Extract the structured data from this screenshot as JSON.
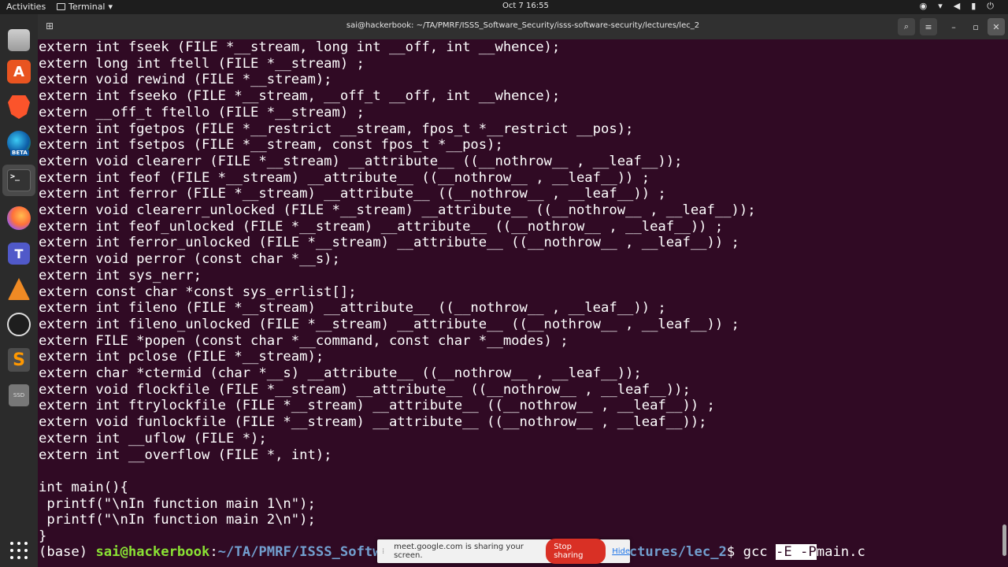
{
  "topbar": {
    "activities": "Activities",
    "app_name": "Terminal",
    "clock": "Oct 7  16:55"
  },
  "dock": {
    "items": [
      "files",
      "app-center",
      "brave",
      "edge-beta",
      "terminal",
      "firefox",
      "teams",
      "vlc",
      "obs",
      "sublime-text",
      "ssd"
    ],
    "edge_badge": "BETA",
    "ssd_label": "SSD"
  },
  "window": {
    "title": "sai@hackerbook: ~/TA/PMRF/ISSS_Software_Security/isss-software-security/lectures/lec_2"
  },
  "terminal": {
    "lines": [
      "extern int fseek (FILE *__stream, long int __off, int __whence);",
      "extern long int ftell (FILE *__stream) ;",
      "extern void rewind (FILE *__stream);",
      "extern int fseeko (FILE *__stream, __off_t __off, int __whence);",
      "extern __off_t ftello (FILE *__stream) ;",
      "extern int fgetpos (FILE *__restrict __stream, fpos_t *__restrict __pos);",
      "extern int fsetpos (FILE *__stream, const fpos_t *__pos);",
      "extern void clearerr (FILE *__stream) __attribute__ ((__nothrow__ , __leaf__));",
      "extern int feof (FILE *__stream) __attribute__ ((__nothrow__ , __leaf__)) ;",
      "extern int ferror (FILE *__stream) __attribute__ ((__nothrow__ , __leaf__)) ;",
      "extern void clearerr_unlocked (FILE *__stream) __attribute__ ((__nothrow__ , __leaf__));",
      "extern int feof_unlocked (FILE *__stream) __attribute__ ((__nothrow__ , __leaf__)) ;",
      "extern int ferror_unlocked (FILE *__stream) __attribute__ ((__nothrow__ , __leaf__)) ;",
      "extern void perror (const char *__s);",
      "extern int sys_nerr;",
      "extern const char *const sys_errlist[];",
      "extern int fileno (FILE *__stream) __attribute__ ((__nothrow__ , __leaf__)) ;",
      "extern int fileno_unlocked (FILE *__stream) __attribute__ ((__nothrow__ , __leaf__)) ;",
      "extern FILE *popen (const char *__command, const char *__modes) ;",
      "extern int pclose (FILE *__stream);",
      "extern char *ctermid (char *__s) __attribute__ ((__nothrow__ , __leaf__));",
      "extern void flockfile (FILE *__stream) __attribute__ ((__nothrow__ , __leaf__));",
      "extern int ftrylockfile (FILE *__stream) __attribute__ ((__nothrow__ , __leaf__)) ;",
      "extern void funlockfile (FILE *__stream) __attribute__ ((__nothrow__ , __leaf__));",
      "extern int __uflow (FILE *);",
      "extern int __overflow (FILE *, int);",
      "",
      "int main(){",
      " printf(\"\\nIn function main 1\\n\");",
      " printf(\"\\nIn function main 2\\n\");",
      "}"
    ],
    "prompt": {
      "prefix": "(base) ",
      "user_host": "sai@hackerbook",
      "colon": ":",
      "path": "~/TA/PMRF/ISSS_Softwa",
      "path_tail": "ty/lectures/lec_2",
      "dollar": "$ ",
      "cmd_start": "gcc ",
      "cmd_selected": "-E -P",
      "cmd_end": "main.c"
    }
  },
  "share_banner": {
    "message": "meet.google.com is sharing your screen.",
    "stop_label": "Stop sharing",
    "hide_label": "Hide"
  }
}
